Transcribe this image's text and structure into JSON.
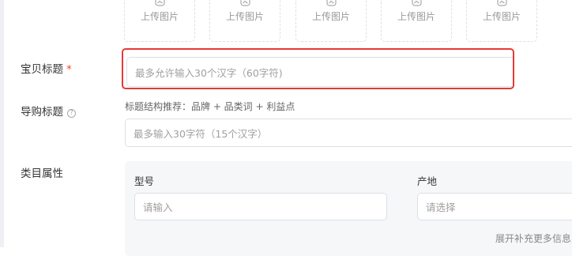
{
  "upload_tiles": [
    {
      "label": "上传图片",
      "icon": "image-upload-icon"
    },
    {
      "label": "上传图片",
      "icon": "image-upload-icon"
    },
    {
      "label": "上传图片",
      "icon": "image-upload-icon"
    },
    {
      "label": "上传图片",
      "icon": "image-upload-icon"
    },
    {
      "label": "上传图片",
      "icon": "image-upload-icon"
    }
  ],
  "title_field": {
    "label": "宝贝标题",
    "required_mark": "*",
    "placeholder": "最多允许输入30个汉字（60字符)"
  },
  "guide_title_field": {
    "label": "导购标题",
    "help_icon": "?",
    "hint": "标题结构推荐：品牌 + 品类词 + 利益点",
    "placeholder": "最多输入30字符（15个汉字）"
  },
  "category_attributes": {
    "label": "类目属性",
    "model": {
      "label": "型号",
      "placeholder": "请输入"
    },
    "origin": {
      "label": "产地",
      "placeholder": "请选择"
    },
    "expand_link": "展开补充更多信息"
  },
  "colors": {
    "highlight_border": "#e53935",
    "required": "#ff3b30",
    "panel_bg": "#f6f7f9"
  }
}
